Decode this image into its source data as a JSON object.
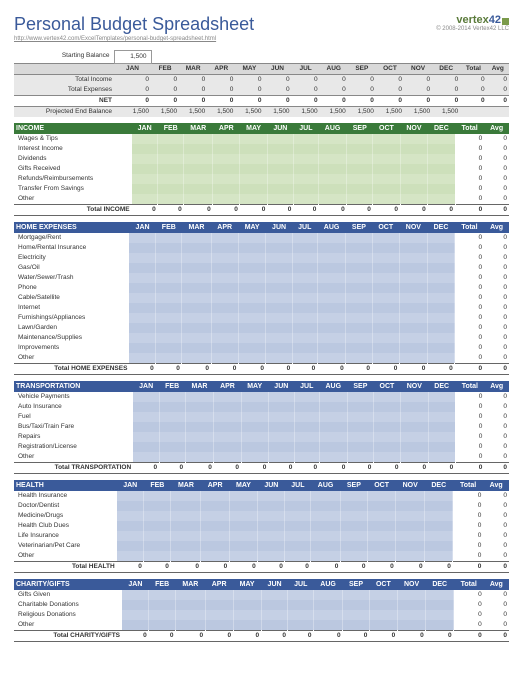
{
  "header": {
    "title": "Personal Budget Spreadsheet",
    "url": "http://www.vertex42.com/ExcelTemplates/personal-budget-spreadsheet.html",
    "logo": "vertex",
    "logo_suffix": "42",
    "copyright": "© 2008-2014 Vertex42 LLC"
  },
  "months": [
    "JAN",
    "FEB",
    "MAR",
    "APR",
    "MAY",
    "JUN",
    "JUL",
    "AUG",
    "SEP",
    "OCT",
    "NOV",
    "DEC"
  ],
  "totals_labels": {
    "total": "Total",
    "avg": "Avg"
  },
  "starting": {
    "label": "Starting Balance",
    "value": "1,500"
  },
  "summary": {
    "rows": [
      {
        "label": "Total Income",
        "vals": [
          "0",
          "0",
          "0",
          "0",
          "0",
          "0",
          "0",
          "0",
          "0",
          "0",
          "0",
          "0"
        ],
        "tot": "0",
        "avg": "0"
      },
      {
        "label": "Total Expenses",
        "vals": [
          "0",
          "0",
          "0",
          "0",
          "0",
          "0",
          "0",
          "0",
          "0",
          "0",
          "0",
          "0"
        ],
        "tot": "0",
        "avg": "0"
      }
    ],
    "net": {
      "label": "NET",
      "vals": [
        "0",
        "0",
        "0",
        "0",
        "0",
        "0",
        "0",
        "0",
        "0",
        "0",
        "0",
        "0"
      ],
      "tot": "0",
      "avg": "0"
    },
    "proj": {
      "label": "Projected End Balance",
      "vals": [
        "1,500",
        "1,500",
        "1,500",
        "1,500",
        "1,500",
        "1,500",
        "1,500",
        "1,500",
        "1,500",
        "1,500",
        "1,500",
        "1,500"
      ],
      "tot": "",
      "avg": ""
    }
  },
  "sections": [
    {
      "name": "INCOME",
      "cls": "income",
      "items": [
        "Wages & Tips",
        "Interest Income",
        "Dividends",
        "Gifts Received",
        "Refunds/Reimbursements",
        "Transfer From Savings",
        "Other"
      ],
      "total_label": "Total INCOME"
    },
    {
      "name": "HOME EXPENSES",
      "cls": "exp",
      "items": [
        "Mortgage/Rent",
        "Home/Rental Insurance",
        "Electricity",
        "Gas/Oil",
        "Water/Sewer/Trash",
        "Phone",
        "Cable/Satellite",
        "Internet",
        "Furnishings/Appliances",
        "Lawn/Garden",
        "Maintenance/Supplies",
        "Improvements",
        "Other"
      ],
      "total_label": "Total HOME EXPENSES"
    },
    {
      "name": "TRANSPORTATION",
      "cls": "exp",
      "items": [
        "Vehicle Payments",
        "Auto Insurance",
        "Fuel",
        "Bus/Taxi/Train Fare",
        "Repairs",
        "Registration/License",
        "Other"
      ],
      "total_label": "Total TRANSPORTATION"
    },
    {
      "name": "HEALTH",
      "cls": "exp",
      "items": [
        "Health Insurance",
        "Doctor/Dentist",
        "Medicine/Drugs",
        "Health Club Dues",
        "Life Insurance",
        "Veterinarian/Pet Care",
        "Other"
      ],
      "total_label": "Total HEALTH"
    },
    {
      "name": "CHARITY/GIFTS",
      "cls": "exp",
      "items": [
        "Gifts Given",
        "Charitable Donations",
        "Religious Donations",
        "Other"
      ],
      "total_label": "Total CHARITY/GIFTS"
    }
  ],
  "zero": "0"
}
